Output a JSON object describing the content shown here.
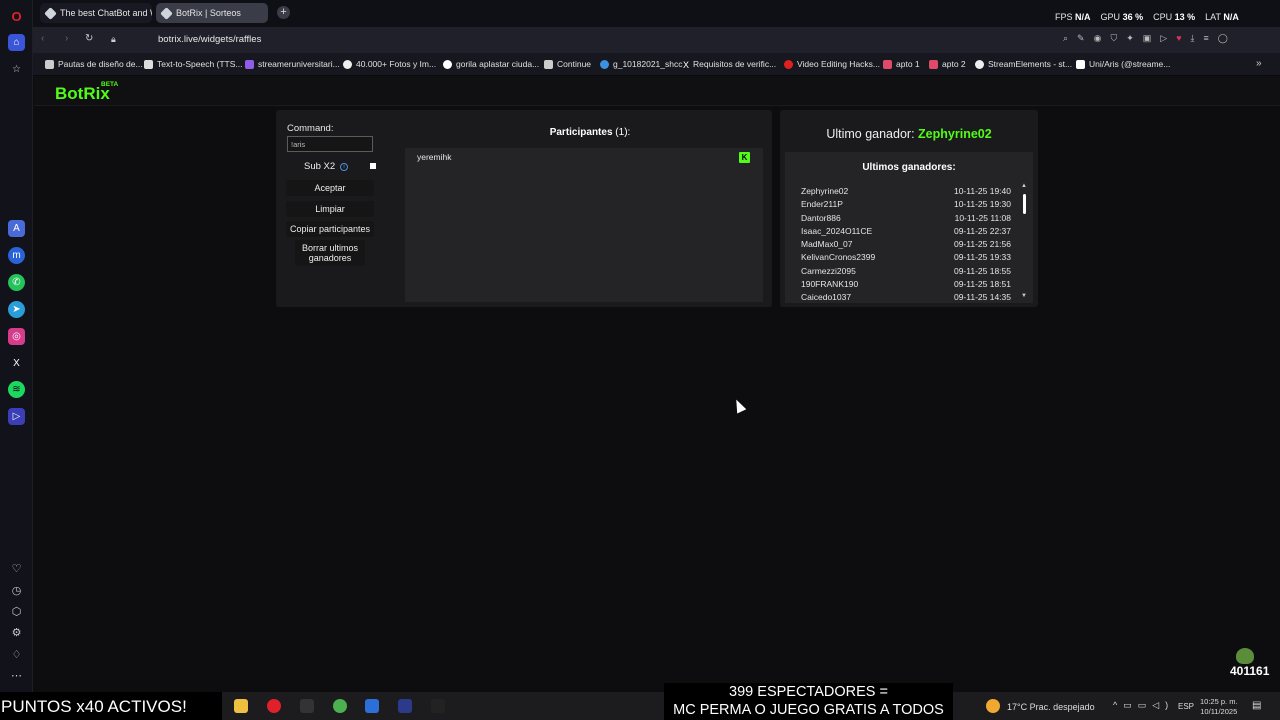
{
  "browser": {
    "tabs": [
      {
        "label": "The best ChatBot and Wid"
      },
      {
        "label": "BotRix | Sorteos"
      }
    ],
    "new_tab_label": "+",
    "url": "botrix.live/widgets/raffles",
    "stats": {
      "fps_label": "FPS",
      "fps": "N/A",
      "gpu_label": "GPU",
      "gpu": "36 %",
      "cpu_label": "CPU",
      "cpu": "13 %",
      "lat_label": "LAT",
      "lat": "N/A"
    },
    "bookmarks": [
      {
        "label": "Pautas de diseño de..."
      },
      {
        "label": "Text-to-Speech (TTS..."
      },
      {
        "label": "streameruniversitari..."
      },
      {
        "label": "40.000+ Fotos y Im..."
      },
      {
        "label": "gorila aplastar ciuda..."
      },
      {
        "label": "Continue"
      },
      {
        "label": "g_10182021_shcc"
      },
      {
        "label": "Requisitos de verific..."
      },
      {
        "label": "Video Editing Hacks..."
      },
      {
        "label": "apto 1"
      },
      {
        "label": "apto 2"
      },
      {
        "label": "StreamElements - st..."
      },
      {
        "label": "Uni/Aris (@streame..."
      }
    ]
  },
  "app": {
    "logo": "BotRix",
    "beta": "BETA"
  },
  "raffle": {
    "command_label": "Command:",
    "command_value": "!aris",
    "sub_label": "Sub X2",
    "accept": "Aceptar",
    "clear": "Limpiar",
    "copy": "Copiar participantes",
    "delete_winners": "Borrar ultimos ganadores",
    "participants_title": "Participantes",
    "participants_count": "(1):",
    "participants": [
      "yeremihk"
    ]
  },
  "winners": {
    "last_winner_label": "Ultimo ganador:",
    "last_winner": "Zephyrine02",
    "list_title": "Ultimos ganadores:",
    "list": [
      {
        "name": "Zephyrine02",
        "date": "10-11-25 19:40"
      },
      {
        "name": "Ender211P",
        "date": "10-11-25 19:30"
      },
      {
        "name": "Dantor886",
        "date": "10-11-25 11:08"
      },
      {
        "name": "Isaac_2024O11CE",
        "date": "09-11-25 22:37"
      },
      {
        "name": "MadMax0_07",
        "date": "09-11-25 21:56"
      },
      {
        "name": "KelivanCronos2399",
        "date": "09-11-25 19:33"
      },
      {
        "name": "Carmezzi2095",
        "date": "09-11-25 18:55"
      },
      {
        "name": "190FRANK190",
        "date": "09-11-25 18:51"
      },
      {
        "name": "Caicedo1037",
        "date": "09-11-25 14:35"
      }
    ]
  },
  "stream_overlay": {
    "ticker": "PUNTOS x40 ACTIVOS!",
    "line1": "399 ESPECTADORES =",
    "line2": "MC PERMA O JUEGO GRATIS A TODOS",
    "counter": "401161"
  },
  "taskbar": {
    "weather": "17°C  Prac. despejado",
    "lang": "ESP",
    "time": "10:25 p. m.",
    "date": "10/11/2025"
  },
  "colors": {
    "accent": "#53fc18"
  }
}
